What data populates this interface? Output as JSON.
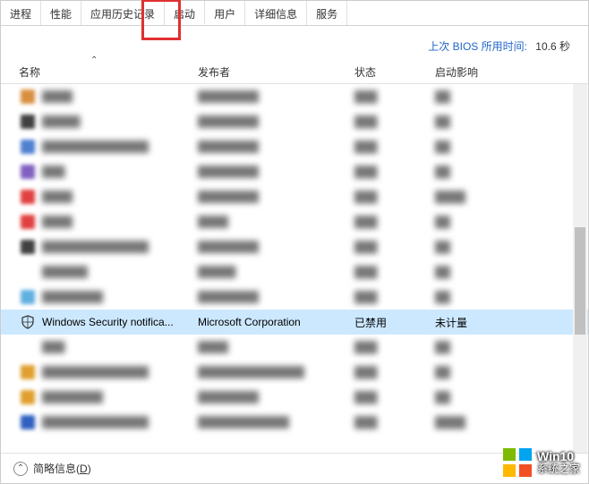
{
  "tabs": {
    "processes": "进程",
    "performance": "性能",
    "app_history": "应用历史记录",
    "startup": "启动",
    "users": "用户",
    "details": "详细信息",
    "services": "服务"
  },
  "bios": {
    "label": "上次 BIOS 所用时间:",
    "value": "10.6 秒"
  },
  "columns": {
    "name": "名称",
    "publisher": "发布者",
    "status": "状态",
    "impact": "启动影响"
  },
  "selected_row": {
    "name": "Windows Security notifica...",
    "publisher": "Microsoft Corporation",
    "status": "已禁用",
    "impact": "未计量"
  },
  "blurred_rows": [
    {
      "c": "#d89040",
      "n": "████",
      "p": "████████",
      "s": "███",
      "i": "██"
    },
    {
      "c": "#404040",
      "n": "█████",
      "p": "████████",
      "s": "███",
      "i": "██"
    },
    {
      "c": "#5080d0",
      "n": "██████████████",
      "p": "████████",
      "s": "███",
      "i": "██"
    },
    {
      "c": "#8060c0",
      "n": "███",
      "p": "████████",
      "s": "███",
      "i": "██"
    },
    {
      "c": "#e04040",
      "n": "████",
      "p": "████████",
      "s": "███",
      "i": "████"
    },
    {
      "c": "#e04040",
      "n": "████",
      "p": "████",
      "s": "███",
      "i": "██"
    },
    {
      "c": "#404040",
      "n": "██████████████",
      "p": "████████",
      "s": "███",
      "i": "██"
    },
    {
      "c": "#ffffff",
      "n": "██████",
      "p": "█████",
      "s": "███",
      "i": "██"
    },
    {
      "c": "#60b0e0",
      "n": "████████",
      "p": "████████",
      "s": "███",
      "i": "██"
    }
  ],
  "blurred_rows_after": [
    {
      "c": "#ffffff",
      "n": "███",
      "p": "████",
      "s": "███",
      "i": "██"
    },
    {
      "c": "#e0a030",
      "n": "██████████████",
      "p": "██████████████",
      "s": "███",
      "i": "██"
    },
    {
      "c": "#e0a030",
      "n": "████████",
      "p": "████████",
      "s": "███",
      "i": "██"
    },
    {
      "c": "#3060c0",
      "n": "██████████████",
      "p": "████████████",
      "s": "███",
      "i": "████"
    }
  ],
  "footer": {
    "less_details": "简略信息",
    "less_details_key": "D"
  },
  "watermark": {
    "top": "Win10",
    "bottom": "系统之家"
  }
}
